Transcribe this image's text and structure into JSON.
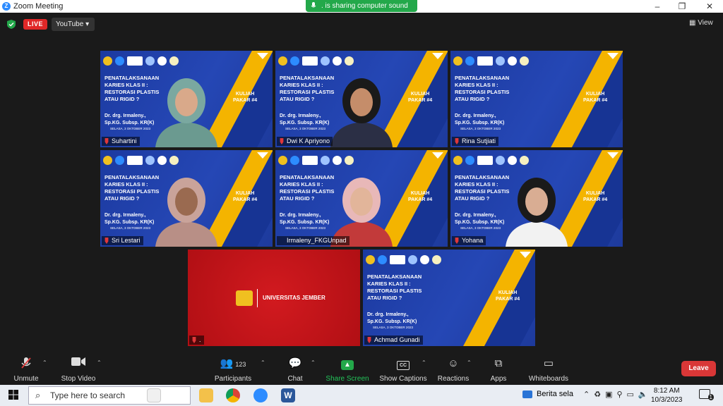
{
  "window": {
    "title": "Zoom Meeting",
    "minimize": "–",
    "maximize": "❐",
    "close": "✕"
  },
  "share_banner": ". is sharing computer sound",
  "status": {
    "live": "LIVE",
    "stream_target": "YouTube ▾",
    "view": "View"
  },
  "slide": {
    "heading": "PENATALAKSANAAN\nKARIES KLAS II :\nRESTORASI PLASTIS\nATAU RIGID ?",
    "doctor": "Dr.   drg.   Irmaleny.,\nSp.KG. Subsp. KR(K)",
    "date": "SELASA, 3 OKTOBER 2023",
    "kuliah": "KULIAH\nPAKAR #4"
  },
  "participants": [
    {
      "name": "Suhartini",
      "muted": true,
      "hijab": "#7aa8a0",
      "skin": "#d9a98a",
      "shirt": "#6b9a90"
    },
    {
      "name": "Dwi K Apriyono",
      "muted": true,
      "hijab": "#1a1a1a",
      "skin": "#c58d6a",
      "shirt": "#2b2f45"
    },
    {
      "name": "Rina Sutjiati",
      "muted": true,
      "hijab": "",
      "skin": "",
      "shirt": ""
    },
    {
      "name": "Sri Lestari",
      "muted": true,
      "hijab": "#c9a39a",
      "skin": "#9a6a50",
      "shirt": "#b88f86"
    },
    {
      "name": "Irmaleny_FKGUnpad",
      "muted": false,
      "hijab": "#e8b8b8",
      "skin": "#e2b59a",
      "shirt": "#c23a3a"
    },
    {
      "name": "Yohana",
      "muted": true,
      "hijab": "#1a1a1a",
      "skin": "#d9ad93",
      "shirt": "#f2f2f2"
    },
    {
      "name": "Achmad Gunadi",
      "muted": true,
      "hijab": "",
      "skin": "",
      "shirt": ""
    }
  ],
  "university_tile": {
    "text": "UNIVERSITAS JEMBER",
    "name": "."
  },
  "toolbar": {
    "unmute": "Unmute",
    "stop_video": "Stop Video",
    "participants": "Participants",
    "participants_count": "123",
    "chat": "Chat",
    "share_screen": "Share Screen",
    "captions": "Show Captions",
    "captions_icon": "CC",
    "reactions": "Reactions",
    "apps": "Apps",
    "whiteboards": "Whiteboards",
    "leave": "Leave"
  },
  "taskbar": {
    "search_placeholder": "Type here to search",
    "news": "Berita sela",
    "time": "8:12 AM",
    "date": "10/3/2023",
    "notif_count": "1"
  },
  "colors": {
    "accent_green": "#23a84a",
    "live_red": "#e02828",
    "active_border": "#e8e05a",
    "slide_blue": "#1f3fa8",
    "slide_yellow": "#f4b400"
  }
}
